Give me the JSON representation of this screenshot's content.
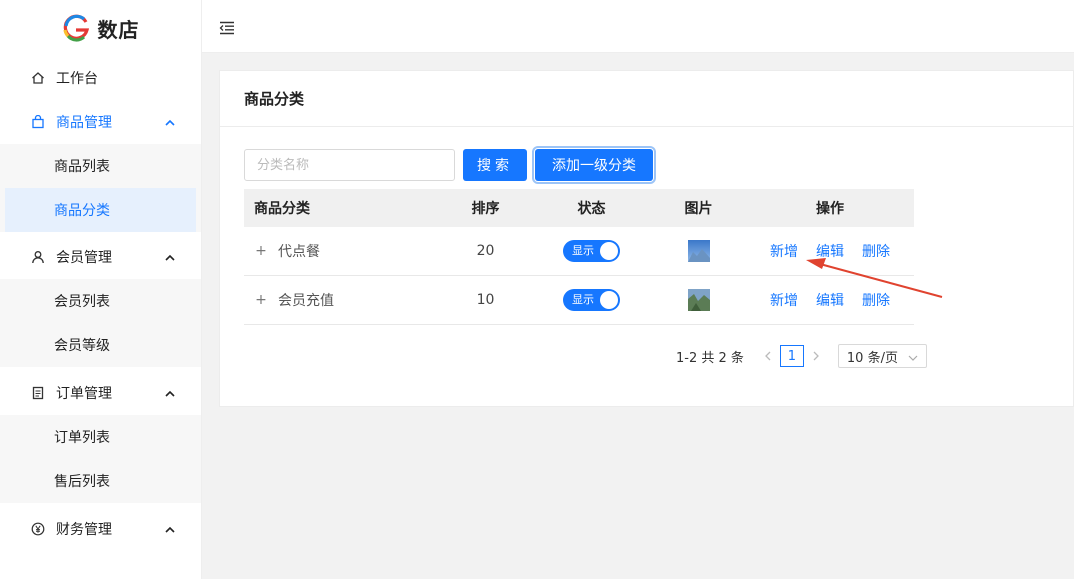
{
  "brand": {
    "name": "数店"
  },
  "sidebar": {
    "items": [
      {
        "label": "工作台",
        "icon": "home-icon"
      },
      {
        "label": "商品管理",
        "icon": "bag-icon",
        "active": true,
        "children": [
          {
            "label": "商品列表"
          },
          {
            "label": "商品分类",
            "active": true
          }
        ]
      },
      {
        "label": "会员管理",
        "icon": "user-icon",
        "children": [
          {
            "label": "会员列表"
          },
          {
            "label": "会员等级"
          }
        ]
      },
      {
        "label": "订单管理",
        "icon": "document-icon",
        "children": [
          {
            "label": "订单列表"
          },
          {
            "label": "售后列表"
          }
        ]
      },
      {
        "label": "财务管理",
        "icon": "yen-icon"
      }
    ]
  },
  "page": {
    "title": "商品分类"
  },
  "search": {
    "placeholder": "分类名称",
    "value": "",
    "button": "搜索",
    "add_button": "添加一级分类"
  },
  "table": {
    "headers": [
      "商品分类",
      "排序",
      "状态",
      "图片",
      "操作"
    ],
    "rows": [
      {
        "name": "代点餐",
        "sort": "20",
        "status": "显示",
        "status_on": true,
        "actions": [
          "新增",
          "编辑",
          "删除"
        ]
      },
      {
        "name": "会员充值",
        "sort": "10",
        "status": "显示",
        "status_on": true,
        "actions": [
          "新增",
          "编辑",
          "删除"
        ]
      }
    ]
  },
  "pagination": {
    "total": "1-2 共 2 条",
    "current": "1",
    "page_size": "10 条/页"
  },
  "colors": {
    "primary": "#1677ff",
    "annotation": "#e0432f"
  }
}
